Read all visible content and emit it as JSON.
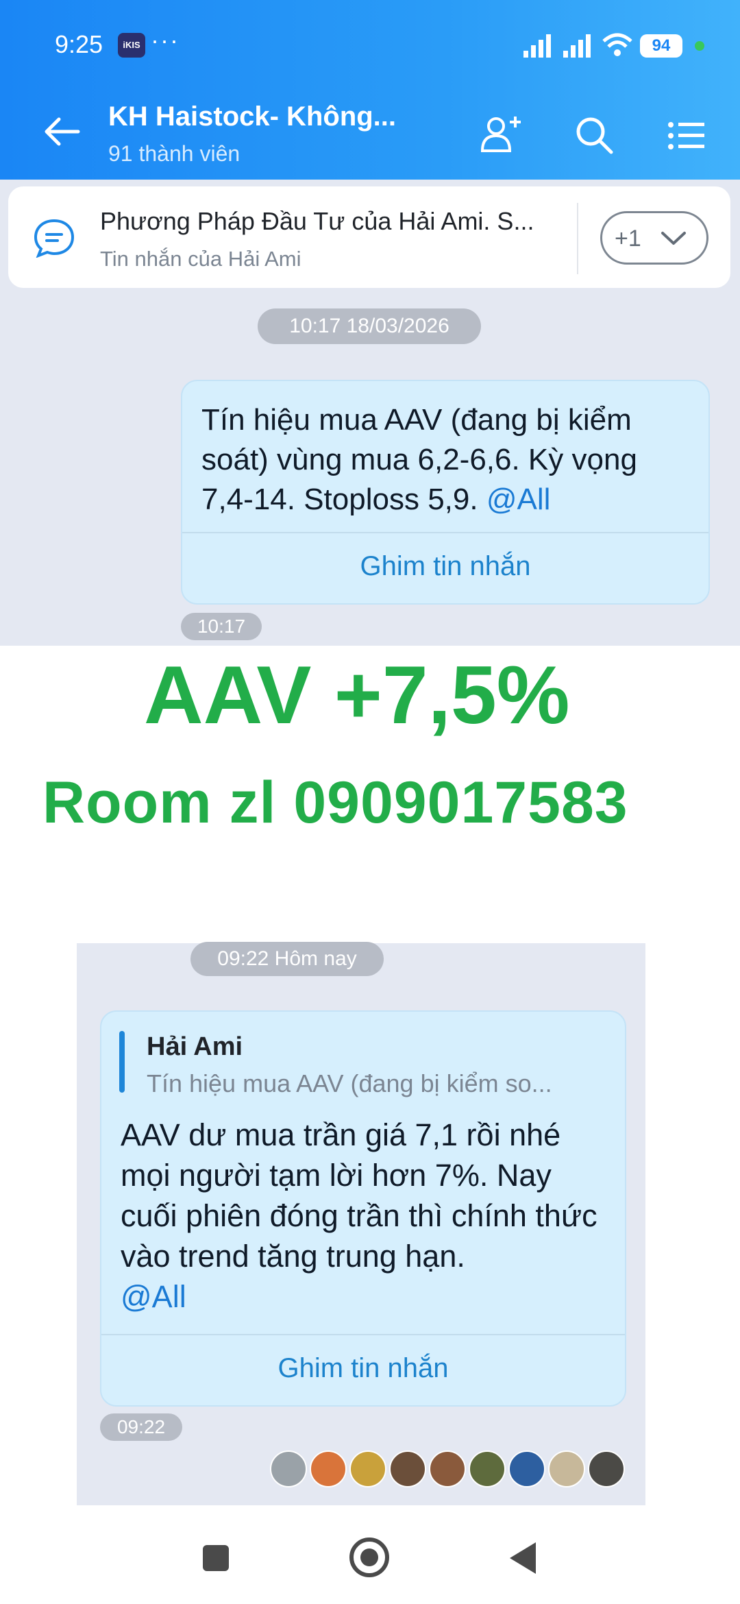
{
  "status_bar": {
    "time": "9:25",
    "app_badge": "iKIS",
    "more": "···",
    "battery": "94",
    "colors": {
      "charging": "#39c85a"
    }
  },
  "header": {
    "title": "KH Haistock- Không...",
    "member_count": "91 thành viên",
    "icons": [
      "back-arrow-icon",
      "add-member-icon",
      "search-icon",
      "menu-list-icon"
    ],
    "accent": "#1a86f5"
  },
  "pinned": {
    "title": "Phương Pháp Đầu Tư của Hải Ami. S...",
    "subtitle": "Tin nhắn của Hải Ami",
    "count": "+1"
  },
  "chat1": {
    "date_pill": "10:17 18/03/2026",
    "message": {
      "text": "Tín hiệu mua AAV (đang bị kiểm soát) vùng mua 6,2-6,6. Kỳ vọng 7,4-14. Stoploss 5,9.",
      "mention": "@All",
      "pin_label": "Ghim tin nhắn",
      "time": "10:17"
    }
  },
  "promo": {
    "line1": "AAV +7,5%",
    "line2": "Room zl 0909017583",
    "color": "#22ad49"
  },
  "chat2": {
    "date_pill": "09:22 Hôm nay",
    "message": {
      "reply_author": "Hải Ami",
      "reply_preview": "Tín hiệu mua AAV (đang bị kiểm so...",
      "text": "AAV dư mua trần giá 7,1 rồi nhé mọi người tạm lời hơn 7%. Nay cuối phiên đóng trần thì chính thức vào trend tăng trung hạn.",
      "mention": "@All",
      "pin_label": "Ghim tin nhắn",
      "time": "09:22"
    },
    "seen_avatars": 9
  },
  "nav": {
    "buttons": [
      "recent-apps",
      "home",
      "back"
    ]
  }
}
